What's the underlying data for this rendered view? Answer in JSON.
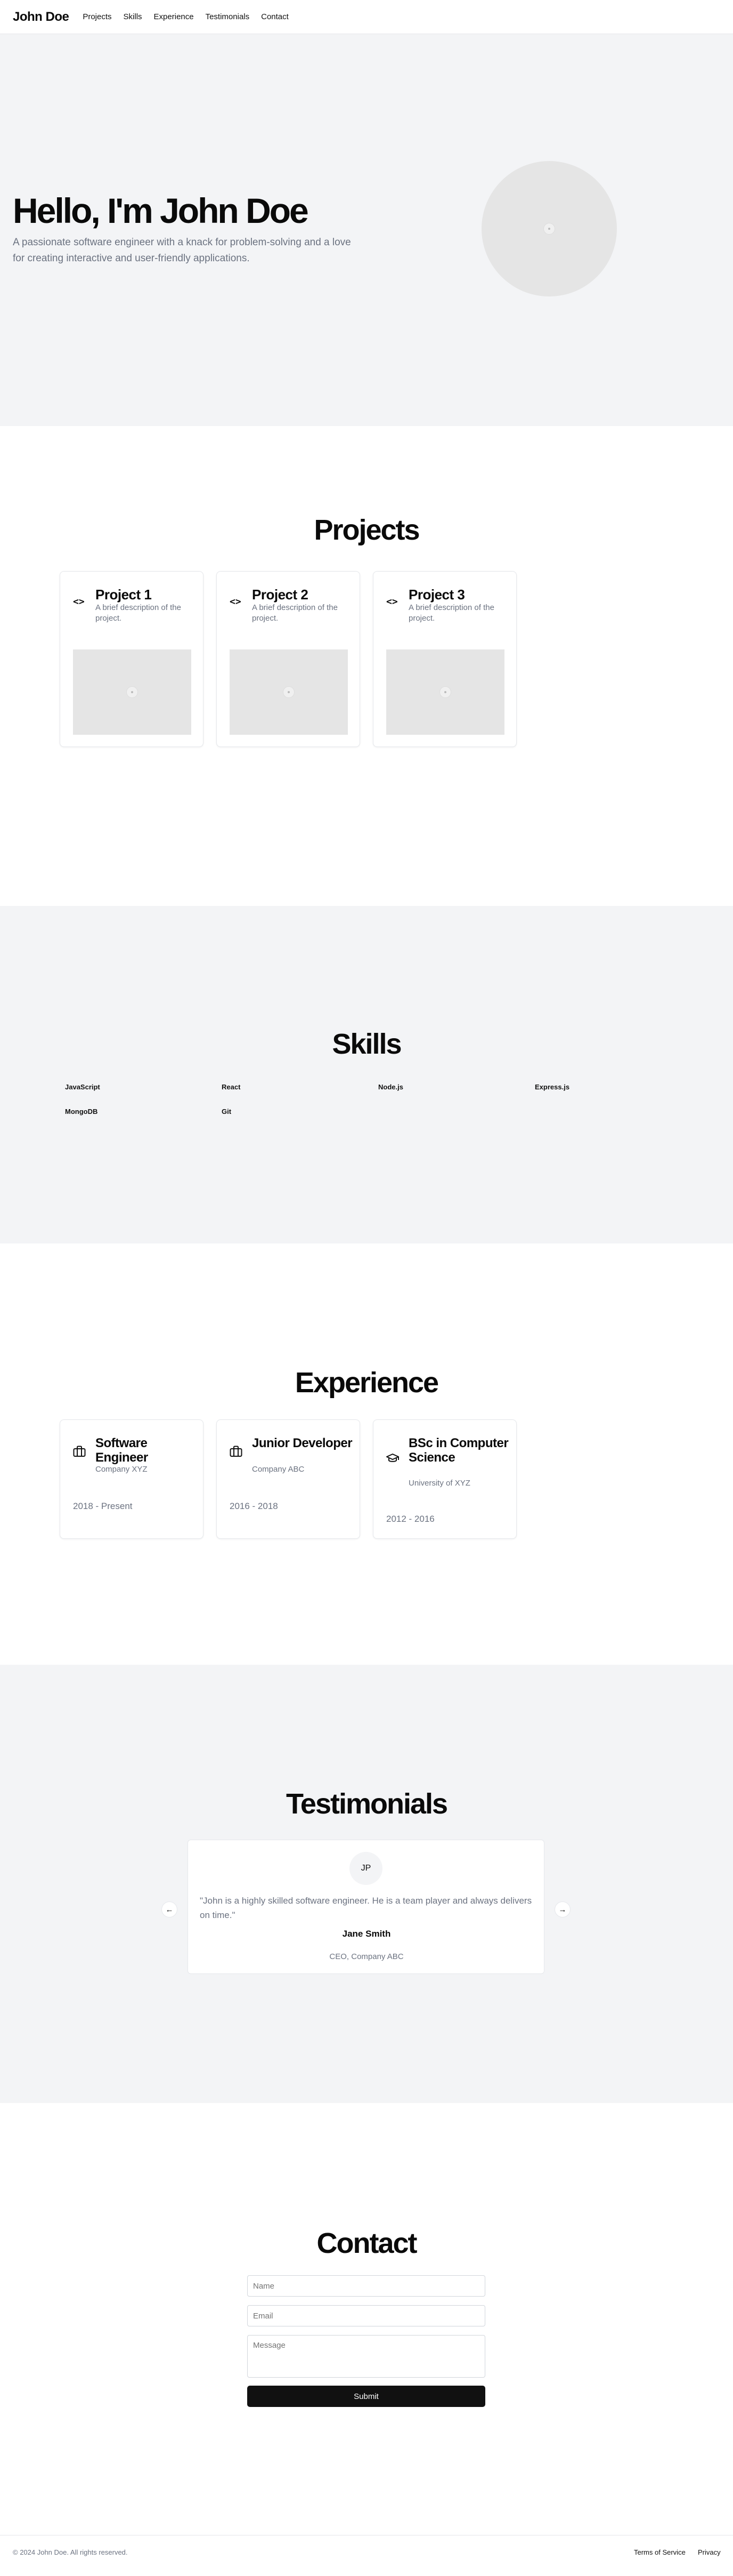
{
  "nav": {
    "brand": "John Doe",
    "links": [
      "Projects",
      "Skills",
      "Experience",
      "Testimonials",
      "Contact"
    ]
  },
  "hero": {
    "title": "Hello, I'm John Doe",
    "subtitle": "A passionate software engineer with a knack for problem-solving and a love for creating interactive and user-friendly applications."
  },
  "projects": {
    "title": "Projects",
    "items": [
      {
        "name": "Project 1",
        "description": "A brief description of the project."
      },
      {
        "name": "Project 2",
        "description": "A brief description of the project."
      },
      {
        "name": "Project 3",
        "description": "A brief description of the project."
      }
    ]
  },
  "skills": {
    "title": "Skills",
    "items": [
      "JavaScript",
      "React",
      "Node.js",
      "Express.js",
      "MongoDB",
      "Git"
    ]
  },
  "experience": {
    "title": "Experience",
    "items": [
      {
        "title": "Software Engineer",
        "organization": "Company XYZ",
        "dates": "2018 - Present",
        "icon": "briefcase-icon"
      },
      {
        "title": "Junior Developer",
        "organization": "Company ABC",
        "dates": "2016 - 2018",
        "icon": "briefcase-icon"
      },
      {
        "title": "BSc in Computer Science",
        "organization": "University of XYZ",
        "dates": "2012 - 2016",
        "icon": "graduation-cap-icon"
      }
    ]
  },
  "testimonials": {
    "title": "Testimonials",
    "initials": "JP",
    "quote": "\"John is a highly skilled software engineer. He is a team player and always delivers on time.\"",
    "name": "Jane Smith",
    "role": "CEO, Company ABC"
  },
  "contact": {
    "title": "Contact",
    "name_placeholder": "Name",
    "email_placeholder": "Email",
    "message_placeholder": "Message",
    "submit_label": "Submit"
  },
  "footer": {
    "copyright": "© 2024 John Doe. All rights reserved.",
    "links": [
      "Terms of Service",
      "Privacy"
    ]
  }
}
